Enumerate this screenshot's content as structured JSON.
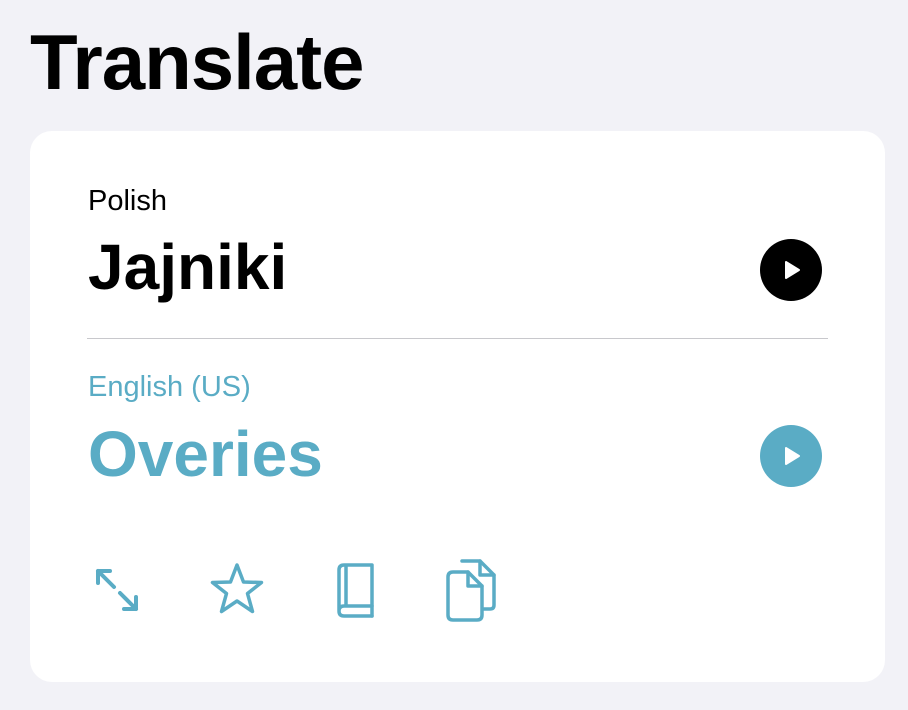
{
  "header": {
    "title": "Translate"
  },
  "translation": {
    "source": {
      "language": "Polish",
      "text": "Jajniki",
      "play_icon": "play-icon"
    },
    "target": {
      "language": "English (US)",
      "text": "Overies",
      "play_icon": "play-icon"
    }
  },
  "actions": [
    {
      "icon": "expand-arrows-icon"
    },
    {
      "icon": "star-icon"
    },
    {
      "icon": "book-icon"
    },
    {
      "icon": "copy-icon"
    }
  ],
  "colors": {
    "background": "#f2f2f7",
    "card": "#ffffff",
    "accent": "#5aacc5",
    "primary_text": "#000000",
    "divider": "#c8c8cc"
  }
}
